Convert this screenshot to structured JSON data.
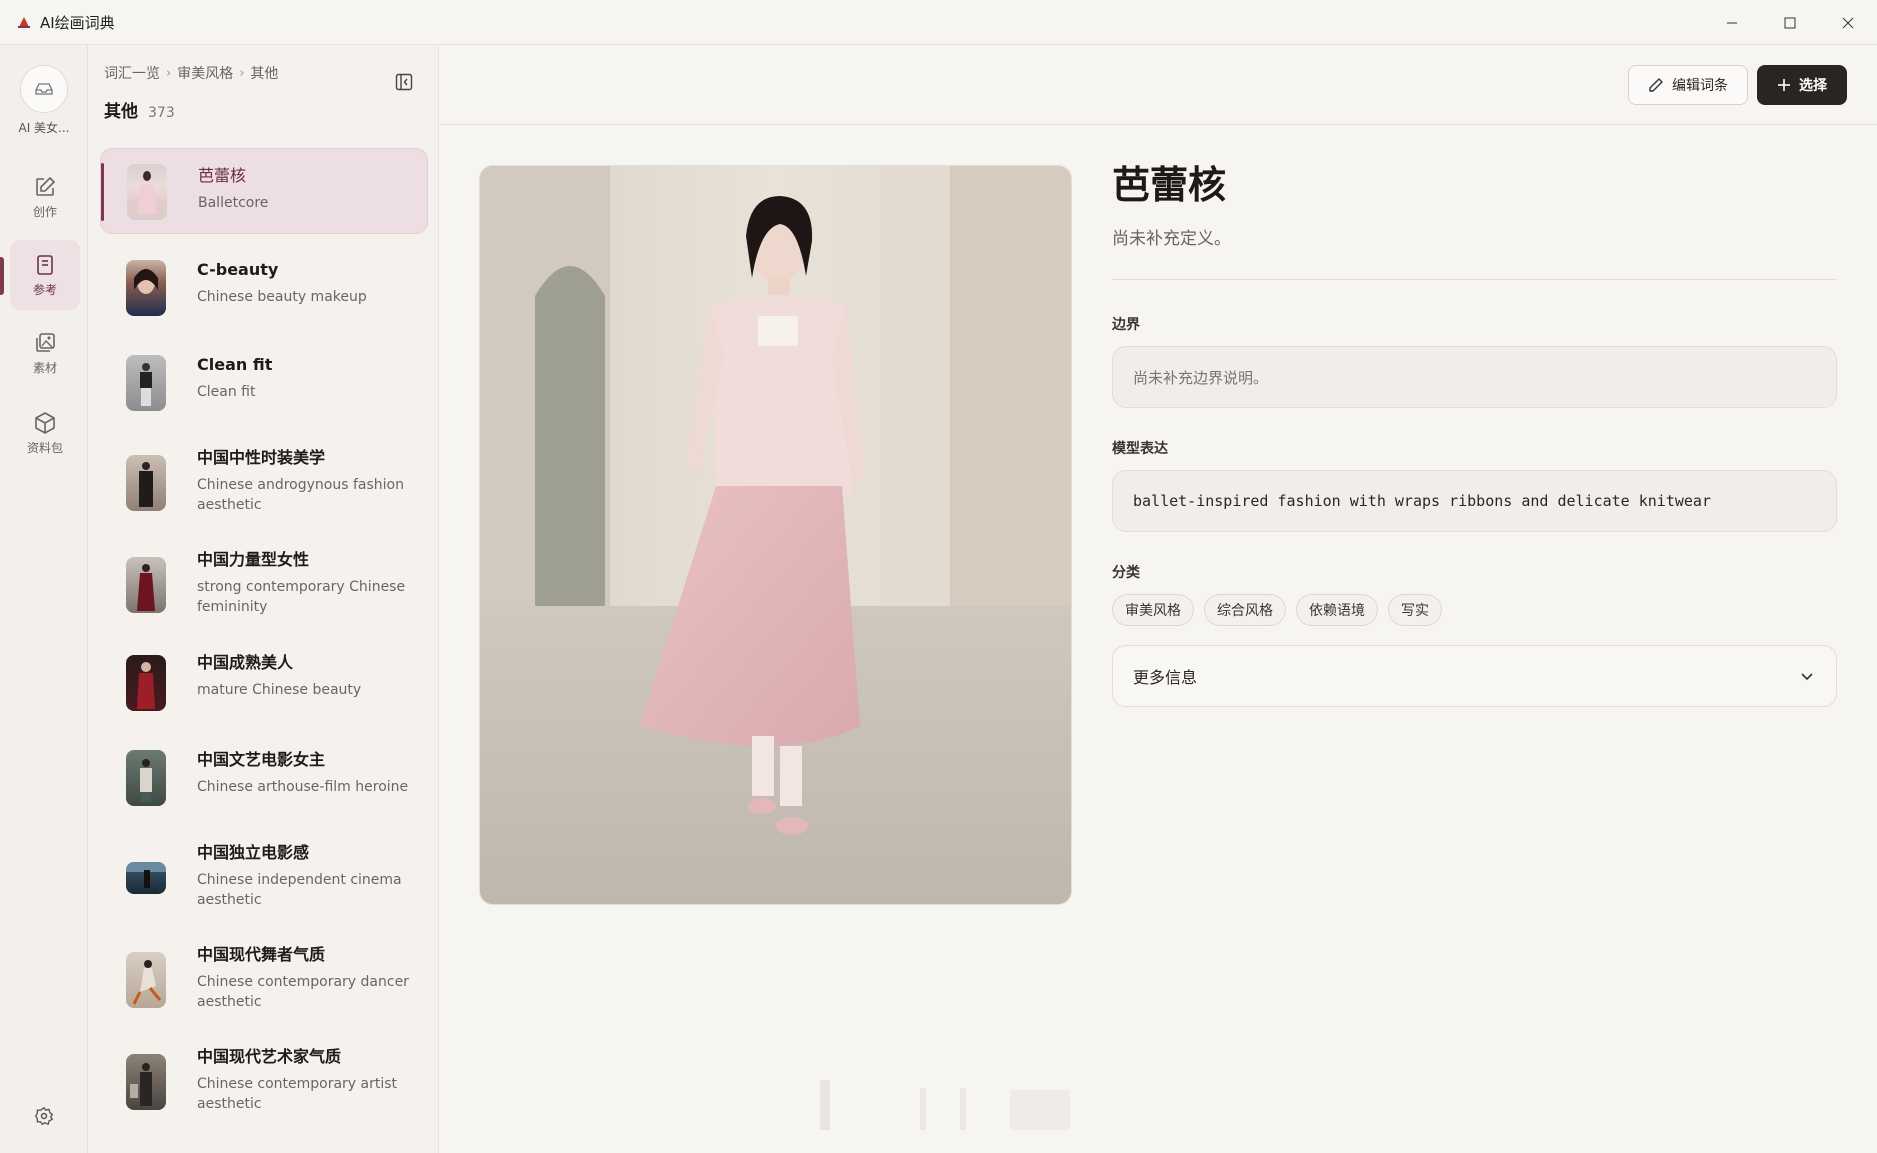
{
  "window": {
    "title": "AI绘画词典"
  },
  "rail": {
    "logo_caption": "AI 美女...",
    "items": [
      {
        "label": "创作",
        "icon": "edit-icon"
      },
      {
        "label": "参考",
        "icon": "book-icon"
      },
      {
        "label": "素材",
        "icon": "images-icon"
      },
      {
        "label": "资料包",
        "icon": "package-icon"
      }
    ]
  },
  "list": {
    "breadcrumb": [
      "词汇一览",
      "审美风格",
      "其他"
    ],
    "title": "其他",
    "count": "373",
    "items": [
      {
        "title": "芭蕾核",
        "subtitle": "Balletcore"
      },
      {
        "title": "C-beauty",
        "subtitle": "Chinese beauty makeup"
      },
      {
        "title": "Clean fit",
        "subtitle": "Clean fit"
      },
      {
        "title": "中国中性时装美学",
        "subtitle": "Chinese androgynous fashion aesthetic"
      },
      {
        "title": "中国力量型女性",
        "subtitle": "strong contemporary Chinese femininity"
      },
      {
        "title": "中国成熟美人",
        "subtitle": "mature Chinese beauty"
      },
      {
        "title": "中国文艺电影女主",
        "subtitle": "Chinese arthouse-film heroine"
      },
      {
        "title": "中国独立电影感",
        "subtitle": "Chinese independent cinema aesthetic"
      },
      {
        "title": "中国现代舞者气质",
        "subtitle": "Chinese contemporary dancer aesthetic"
      },
      {
        "title": "中国现代艺术家气质",
        "subtitle": "Chinese contemporary artist aesthetic"
      }
    ]
  },
  "toolbar": {
    "edit_label": "编辑词条",
    "select_label": "选择"
  },
  "detail": {
    "title": "芭蕾核",
    "definition": "尚未补充定义。",
    "boundary_label": "边界",
    "boundary_value": "尚未补充边界说明。",
    "model_label": "模型表达",
    "model_value": "ballet-inspired fashion with wraps ribbons and delicate knitwear",
    "category_label": "分类",
    "categories": [
      "审美风格",
      "综合风格",
      "依赖语境",
      "写实"
    ],
    "more_label": "更多信息"
  },
  "colors": {
    "accent": "#7d3a4f",
    "selected_bg": "#ecdee2",
    "primary_button": "#2b2522"
  }
}
